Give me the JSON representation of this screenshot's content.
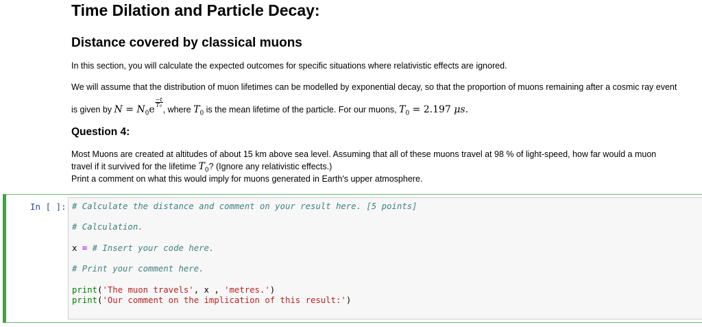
{
  "heading": "Time Dilation and Particle Decay:",
  "subheading": "Distance covered by classical muons",
  "intro": "In this section, you will calculate the expected outcomes for specific situations where relativistic effects are ignored.",
  "assume_line1": "We will assume that the distribution of muon lifetimes can be modelled by exponential decay, so that the proportion of muons remaining after a cosmic ray event",
  "assume_line2": {
    "prefix": "is given by ",
    "formula_lhs": "N",
    "equals": " = ",
    "formula_rhs_base": "N",
    "sub0": "0",
    "e": "e",
    "exp_num": "−t",
    "exp_den": "T₀",
    "mid": ", where ",
    "T0": "T",
    "mid2": " is the mean lifetime of the particle. For our muons, ",
    "T0b": "T",
    "value": " = 2.197 ",
    "unit": "μs."
  },
  "question_title": "Question 4:",
  "q_line1": "Most Muons are created at altitudes of about 15 km above sea level. Assuming that all of these muons travel at 98 % of light-speed, how far would a muon",
  "q_line2_prefix": "travel if it survived for the lifetime ",
  "q_line2_suffix": "? (Ignore any relativistic effects.)",
  "q_line3": "Print a comment on what this would imply for muons generated in Earth's upper atmosphere.",
  "cell": {
    "prompt": "In [ ]:",
    "line1": "# Calculate the distance and comment on your result here. [5 points]",
    "line2": "# Calculation.",
    "line3_var": "x",
    "line3_eq": "=",
    "line3_comment": "# Insert your code here.",
    "line4": "# Print your comment here.",
    "print_kw": "print",
    "p1_open": "(",
    "p1_str1": "'The muon travels'",
    "p1_mid": ", x , ",
    "p1_str2": "'metres.'",
    "p1_close": ")",
    "p2_open": "(",
    "p2_str": "'Our comment on the implication of this result:'",
    "p2_close": ")"
  }
}
